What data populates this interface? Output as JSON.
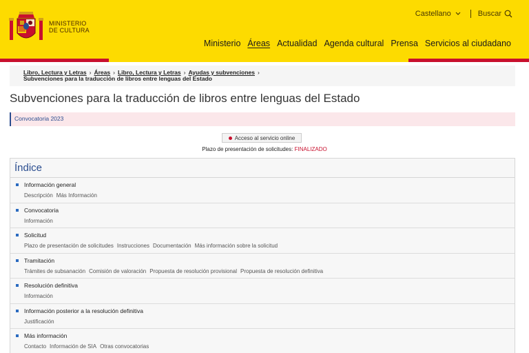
{
  "header": {
    "logo_line1": "MINISTERIO",
    "logo_line2": "DE CULTURA",
    "language": "Castellano",
    "search_label": "Buscar",
    "nav": [
      {
        "label": "Ministerio",
        "active": false
      },
      {
        "label": "Áreas",
        "active": true
      },
      {
        "label": "Actualidad",
        "active": false
      },
      {
        "label": "Agenda cultural",
        "active": false
      },
      {
        "label": "Prensa",
        "active": false
      },
      {
        "label": "Servicios al ciudadano",
        "active": false
      }
    ],
    "colors": {
      "yellow": "#fddb00",
      "red": "#c8102e"
    }
  },
  "breadcrumb": {
    "crumbs": [
      "Libro, Lectura y Letras",
      "Áreas",
      "Libro, Lectura y Letras",
      "Ayudas y subvenciones"
    ],
    "current": "Subvenciones para la traducción de libros entre lenguas del Estado"
  },
  "page": {
    "title": "Subvenciones para la traducción de libros entre lenguas del Estado",
    "convocatoria": "Convocatoria 2023",
    "online_button": "Acceso al servicio online",
    "plazo_label": "Plazo de presentación de solicitudes:",
    "plazo_status": "FINALIZADO"
  },
  "indice": {
    "title": "Índice",
    "sections": [
      {
        "title": "Información general",
        "links": [
          "Descripción",
          "Más Información"
        ]
      },
      {
        "title": "Convocatoria",
        "links": [
          "Información"
        ]
      },
      {
        "title": "Solicitud",
        "links": [
          "Plazo de presentación de solicitudes",
          "Instrucciones",
          "Documentación",
          "Más información sobre la solicitud"
        ]
      },
      {
        "title": "Tramitación",
        "links": [
          "Trámites de subsanación",
          "Comisión de valoración",
          "Propuesta de resolución provisional",
          "Propuesta de resolución definitiva"
        ]
      },
      {
        "title": "Resolución definitiva",
        "links": [
          "Información"
        ]
      },
      {
        "title": "Información posterior a la resolución definitiva",
        "links": [
          "Justificación"
        ]
      },
      {
        "title": "Más información",
        "links": [
          "Contacto",
          "Información de SIA",
          "Otras convocatorias"
        ]
      }
    ]
  }
}
